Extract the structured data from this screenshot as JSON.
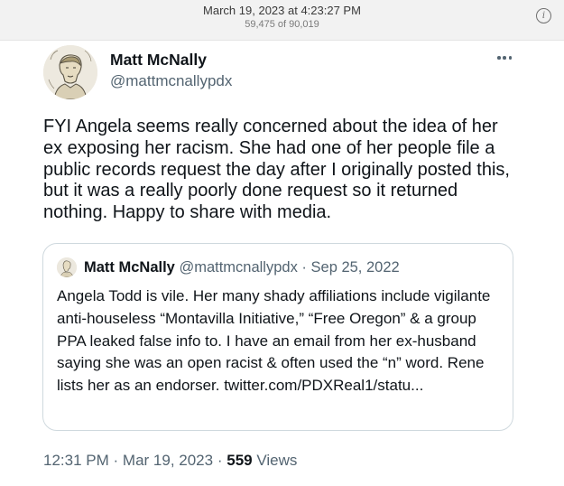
{
  "window": {
    "date": "March 19, 2023 at 4:23:27 PM",
    "counter": "59,475 of 90,019"
  },
  "icons": {
    "info": "info-icon",
    "more": "more-horizontal-icon",
    "avatar": "user-avatar-sketch"
  },
  "tweet": {
    "author_name": "Matt McNally",
    "author_handle": "@mattmcnallypdx",
    "text": "FYI Angela seems really concerned about the idea of her ex exposing her racism. She had one of her people file a public records request the day after I originally posted this, but it was a really poorly done request so it returned nothing. Happy to share with media.",
    "time": "12:31 PM",
    "dot": "·",
    "date": "Mar 19, 2023",
    "views_count": "559",
    "views_label": "Views"
  },
  "quote": {
    "author_name": "Matt McNally",
    "author_handle": "@mattmcnallypdx",
    "dot": "·",
    "date": "Sep 25, 2022",
    "text": "Angela Todd is vile. Her many shady affiliations include vigilante anti-houseless “Montavilla Initiative,” “Free Oregon” & a group PPA leaked false info to. I have an email from her ex-husband saying she was an open racist & often used the “n” word. Rene lists her as an endorser. twitter.com/PDXReal1/statu..."
  },
  "colors": {
    "text": "#0f1419",
    "secondary": "#536471",
    "border": "#cfd9de"
  }
}
